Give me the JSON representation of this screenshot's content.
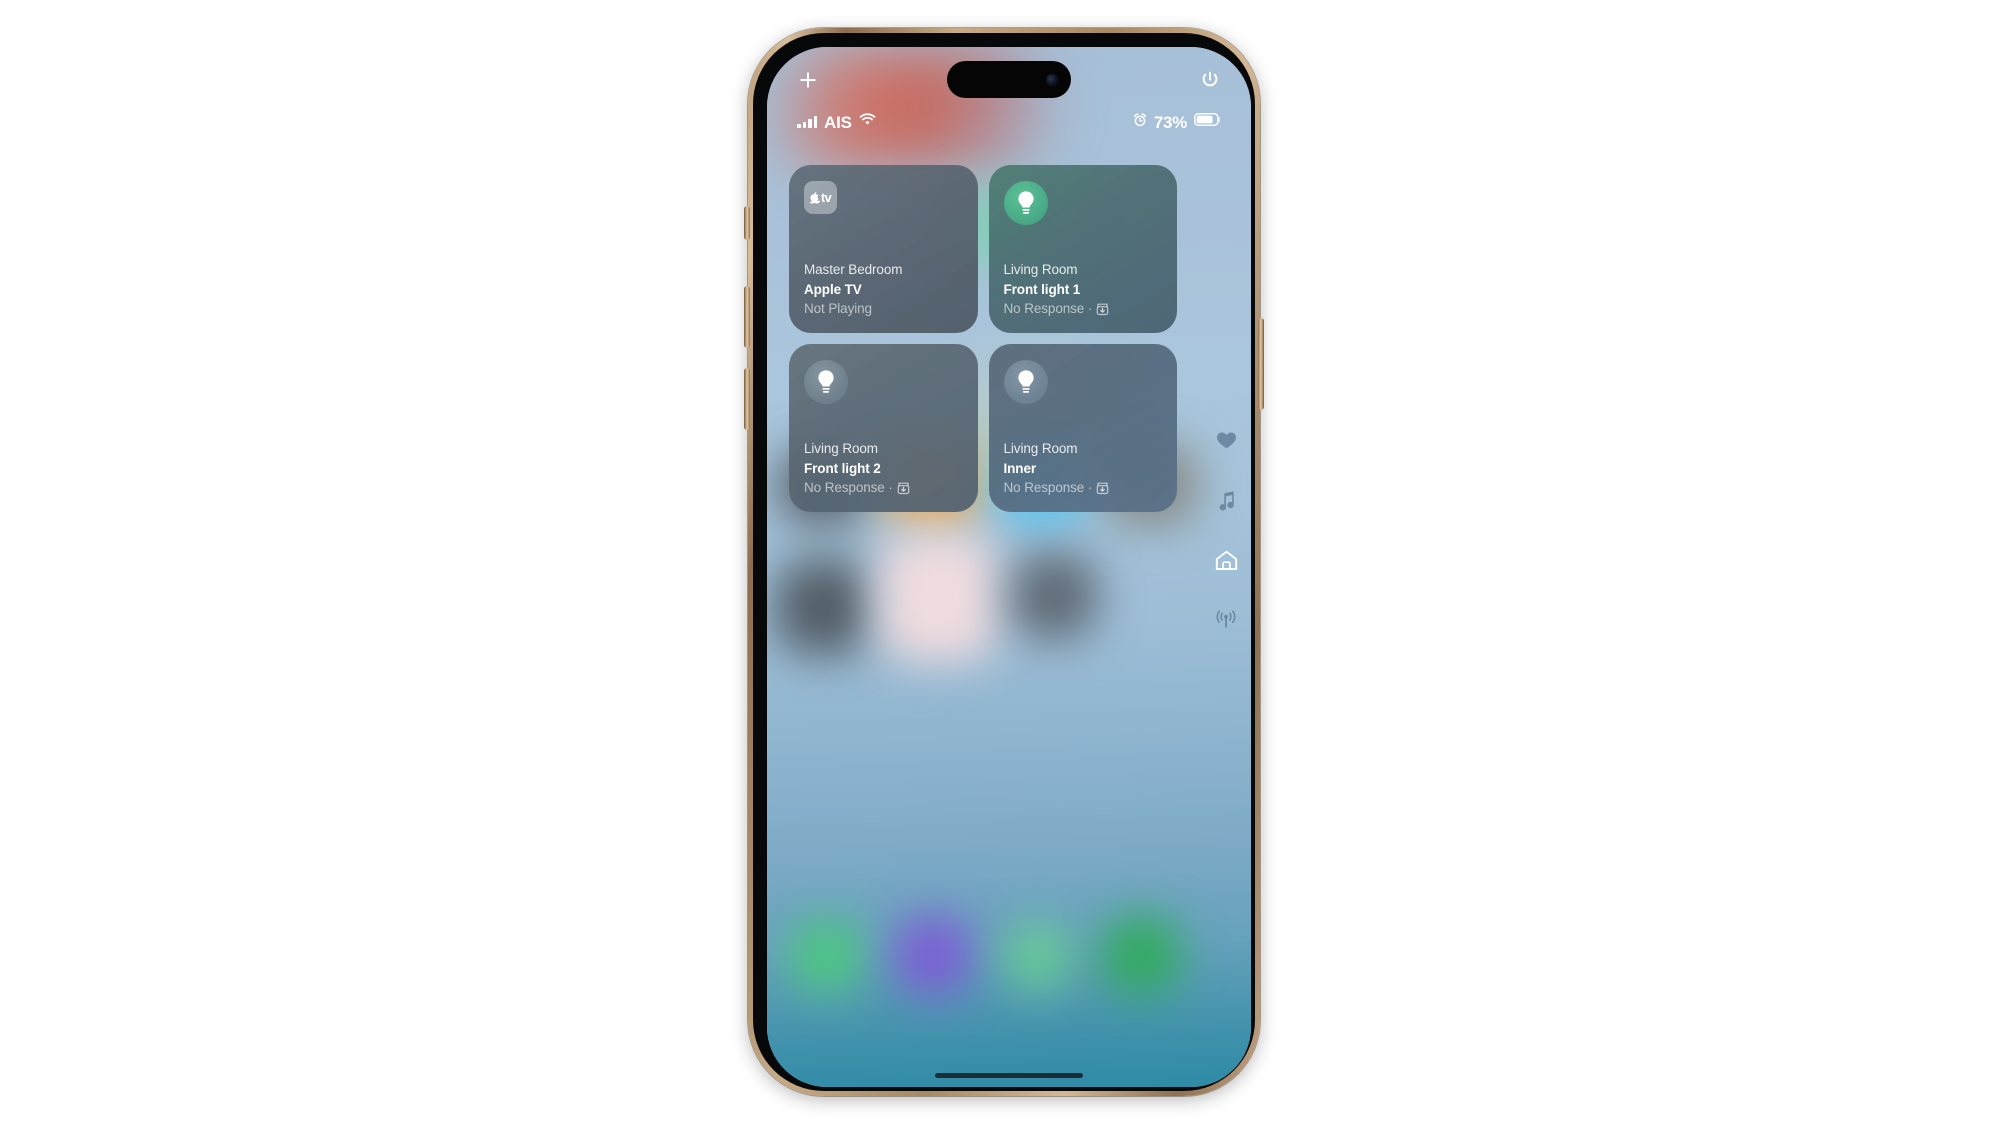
{
  "app": {
    "name": "Home",
    "platform": "iOS"
  },
  "topbar": {
    "add_label": "+",
    "add_icon": "plus-icon",
    "power_icon": "power-icon"
  },
  "status_bar": {
    "signal_icon": "cellular-bars-icon",
    "carrier": "AIS",
    "wifi_icon": "wifi-icon",
    "alarm_icon": "alarm-clock-icon",
    "battery_percent": "73%",
    "battery_icon": "battery-icon",
    "battery_level": 73
  },
  "tiles": [
    {
      "id": "apple-tv",
      "icon": "apple-tv-icon",
      "icon_style": "appletv-box",
      "room": "Master Bedroom",
      "name": "Apple TV",
      "status": "Not Playing",
      "has_update_badge": false,
      "theme": "t-appletv"
    },
    {
      "id": "front-light-1",
      "icon": "lightbulb-icon",
      "icon_style": "bulb-on",
      "room": "Living Room",
      "name": "Front light 1",
      "status": "No Response ·",
      "has_update_badge": true,
      "update_icon": "software-update-icon",
      "theme": "t-green"
    },
    {
      "id": "front-light-2",
      "icon": "lightbulb-icon",
      "icon_style": "bulb-off1",
      "room": "Living Room",
      "name": "Front light 2",
      "status": "No Response ·",
      "has_update_badge": true,
      "update_icon": "software-update-icon",
      "theme": "t-grayblue"
    },
    {
      "id": "inner",
      "icon": "lightbulb-icon",
      "icon_style": "bulb-off2",
      "room": "Living Room",
      "name": "Inner",
      "status": "No Response ·",
      "has_update_badge": true,
      "update_icon": "software-update-icon",
      "theme": "t-blue"
    }
  ],
  "rail": [
    {
      "id": "favorites",
      "icon": "heart-icon",
      "label": "Favorites",
      "active": false
    },
    {
      "id": "media",
      "icon": "music-note-icon",
      "label": "Media",
      "active": false
    },
    {
      "id": "home",
      "icon": "house-icon",
      "label": "Home",
      "active": true
    },
    {
      "id": "broadcast",
      "icon": "broadcast-icon",
      "label": "Broadcast",
      "active": false
    }
  ],
  "colors": {
    "accent_green": "#4ab08a",
    "wallpaper_top": "#a6c0d8",
    "wallpaper_bottom": "#2e8ba6",
    "frame_gold": "#c6a782",
    "status_text": "#ffffff"
  },
  "device": {
    "frame": "gold-titanium",
    "island": "dynamic-island",
    "home_indicator": "home-indicator"
  }
}
